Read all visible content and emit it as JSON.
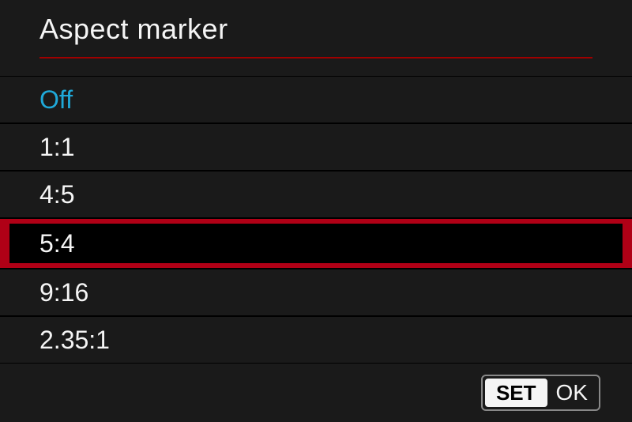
{
  "header": {
    "title": "Aspect marker"
  },
  "options": [
    {
      "label": "Off",
      "active": true,
      "highlighted": false
    },
    {
      "label": "1:1",
      "active": false,
      "highlighted": false
    },
    {
      "label": "4:5",
      "active": false,
      "highlighted": false
    },
    {
      "label": "5:4",
      "active": false,
      "highlighted": true
    },
    {
      "label": "9:16",
      "active": false,
      "highlighted": false
    },
    {
      "label": "2.35:1",
      "active": false,
      "highlighted": false
    }
  ],
  "footer": {
    "set_label": "SET",
    "ok_label": "OK"
  }
}
